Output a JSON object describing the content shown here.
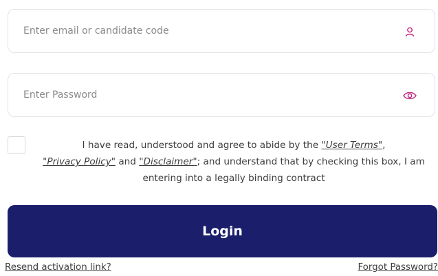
{
  "email": {
    "placeholder": "Enter email or candidate code",
    "icon": "user-icon"
  },
  "password": {
    "placeholder": "Enter Password",
    "icon": "eye-icon"
  },
  "terms": {
    "part1": "I have read, understood and agree to abide by the ",
    "user_terms": "\"User Terms\"",
    "comma": ", ",
    "privacy_policy": "\"Privacy Policy\"",
    "and": " and ",
    "disclaimer": "\"Disclaimer\"",
    "part2": "; and understand that by checking this box, I am entering into a legally binding contract"
  },
  "login": {
    "label": "Login"
  },
  "links": {
    "resend": "Resend activation link?",
    "forgot": "Forgot Password?"
  },
  "colors": {
    "accent": "#1b1f6b",
    "icon": "#c2267a"
  }
}
